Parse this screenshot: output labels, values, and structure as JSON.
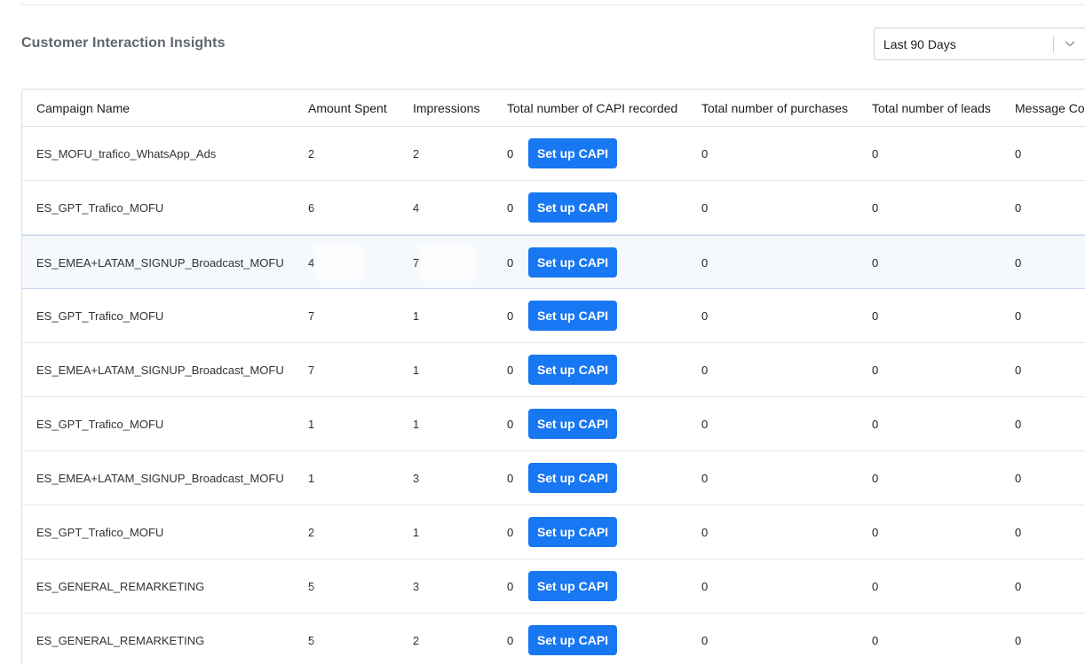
{
  "section": {
    "title": "Customer Interaction Insights"
  },
  "date_filter": {
    "value": "Last 90 Days"
  },
  "table": {
    "columns": [
      "Campaign Name",
      "Amount Spent",
      "Impressions",
      "Total number of CAPI recorded",
      "Total number of purchases",
      "Total number of leads",
      "Message Con"
    ],
    "button_label": "Set up CAPI",
    "rows": [
      {
        "name": "ES_MOFU_trafico_WhatsApp_Ads",
        "amount": "2",
        "impressions": "2",
        "capi": "0",
        "purchases": "0",
        "leads": "0",
        "messages": "0"
      },
      {
        "name": "ES_GPT_Trafico_MOFU",
        "amount": "6",
        "impressions": "4",
        "capi": "0",
        "purchases": "0",
        "leads": "0",
        "messages": "0"
      },
      {
        "name": "ES_EMEA+LATAM_SIGNUP_Broadcast_MOFU",
        "amount": "4",
        "impressions": "7",
        "capi": "0",
        "purchases": "0",
        "leads": "0",
        "messages": "0"
      },
      {
        "name": "ES_GPT_Trafico_MOFU",
        "amount": "7",
        "impressions": "1",
        "capi": "0",
        "purchases": "0",
        "leads": "0",
        "messages": "0"
      },
      {
        "name": "ES_EMEA+LATAM_SIGNUP_Broadcast_MOFU",
        "amount": "7",
        "impressions": "1",
        "capi": "0",
        "purchases": "0",
        "leads": "0",
        "messages": "0"
      },
      {
        "name": "ES_GPT_Trafico_MOFU",
        "amount": "1",
        "impressions": "1",
        "capi": "0",
        "purchases": "0",
        "leads": "0",
        "messages": "0"
      },
      {
        "name": "ES_EMEA+LATAM_SIGNUP_Broadcast_MOFU",
        "amount": "1",
        "impressions": "3",
        "capi": "0",
        "purchases": "0",
        "leads": "0",
        "messages": "0"
      },
      {
        "name": "ES_GPT_Trafico_MOFU",
        "amount": "2",
        "impressions": "1",
        "capi": "0",
        "purchases": "0",
        "leads": "0",
        "messages": "0"
      },
      {
        "name": "ES_GENERAL_REMARKETING",
        "amount": "5",
        "impressions": "3",
        "capi": "0",
        "purchases": "0",
        "leads": "0",
        "messages": "0"
      },
      {
        "name": "ES_GENERAL_REMARKETING",
        "amount": "5",
        "impressions": "2",
        "capi": "0",
        "purchases": "0",
        "leads": "0",
        "messages": "0"
      }
    ]
  },
  "colors": {
    "accent": "#1877f2",
    "highlight_row": "#f5f8fd"
  }
}
